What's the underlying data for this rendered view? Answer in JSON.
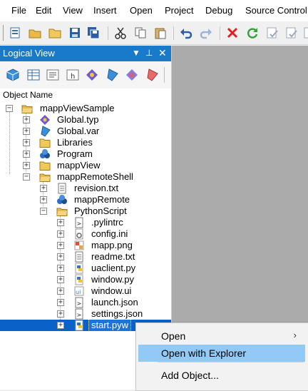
{
  "menubar": {
    "items": [
      "File",
      "Edit",
      "View",
      "Insert",
      "Open",
      "Project",
      "Debug",
      "Source Control"
    ]
  },
  "panel": {
    "title": "Logical View",
    "column_header": "Object Name"
  },
  "tree": {
    "root": "mappViewSample",
    "items": [
      {
        "label": "Global.typ",
        "icon": "datatype-icon"
      },
      {
        "label": "Global.var",
        "icon": "variable-icon"
      },
      {
        "label": "Libraries",
        "icon": "folder-icon"
      },
      {
        "label": "Program",
        "icon": "program-icon"
      },
      {
        "label": "mappView",
        "icon": "folder-icon"
      },
      {
        "label": "mappRemoteShell",
        "icon": "folder-open-icon"
      },
      {
        "label": "revision.txt",
        "icon": "text-file-icon"
      },
      {
        "label": "mappRemote",
        "icon": "program-icon"
      },
      {
        "label": "PythonScript",
        "icon": "folder-open-icon"
      },
      {
        "label": ".pylintrc",
        "icon": "script-file-icon"
      },
      {
        "label": "config.ini",
        "icon": "config-file-icon"
      },
      {
        "label": "mapp.png",
        "icon": "image-file-icon"
      },
      {
        "label": "readme.txt",
        "icon": "text-file-icon"
      },
      {
        "label": "uaclient.py",
        "icon": "python-file-icon"
      },
      {
        "label": "window.py",
        "icon": "python-file-icon"
      },
      {
        "label": "window.ui",
        "icon": "ui-file-icon"
      },
      {
        "label": "launch.json",
        "icon": "script-file-icon"
      },
      {
        "label": "settings.json",
        "icon": "script-file-icon"
      },
      {
        "label": "start.pyw",
        "icon": "python-file-icon"
      }
    ]
  },
  "context_menu": {
    "items": [
      {
        "label": "Open",
        "arrow": "›"
      },
      {
        "label": "Open with Explorer",
        "arrow": ""
      },
      {
        "label": "Add Object...",
        "arrow": ""
      }
    ]
  },
  "colors": {
    "title_bar": "#1979ca",
    "selection": "#0a62c9",
    "menu_highlight": "#91c9f7",
    "workspace": "#ababab"
  }
}
